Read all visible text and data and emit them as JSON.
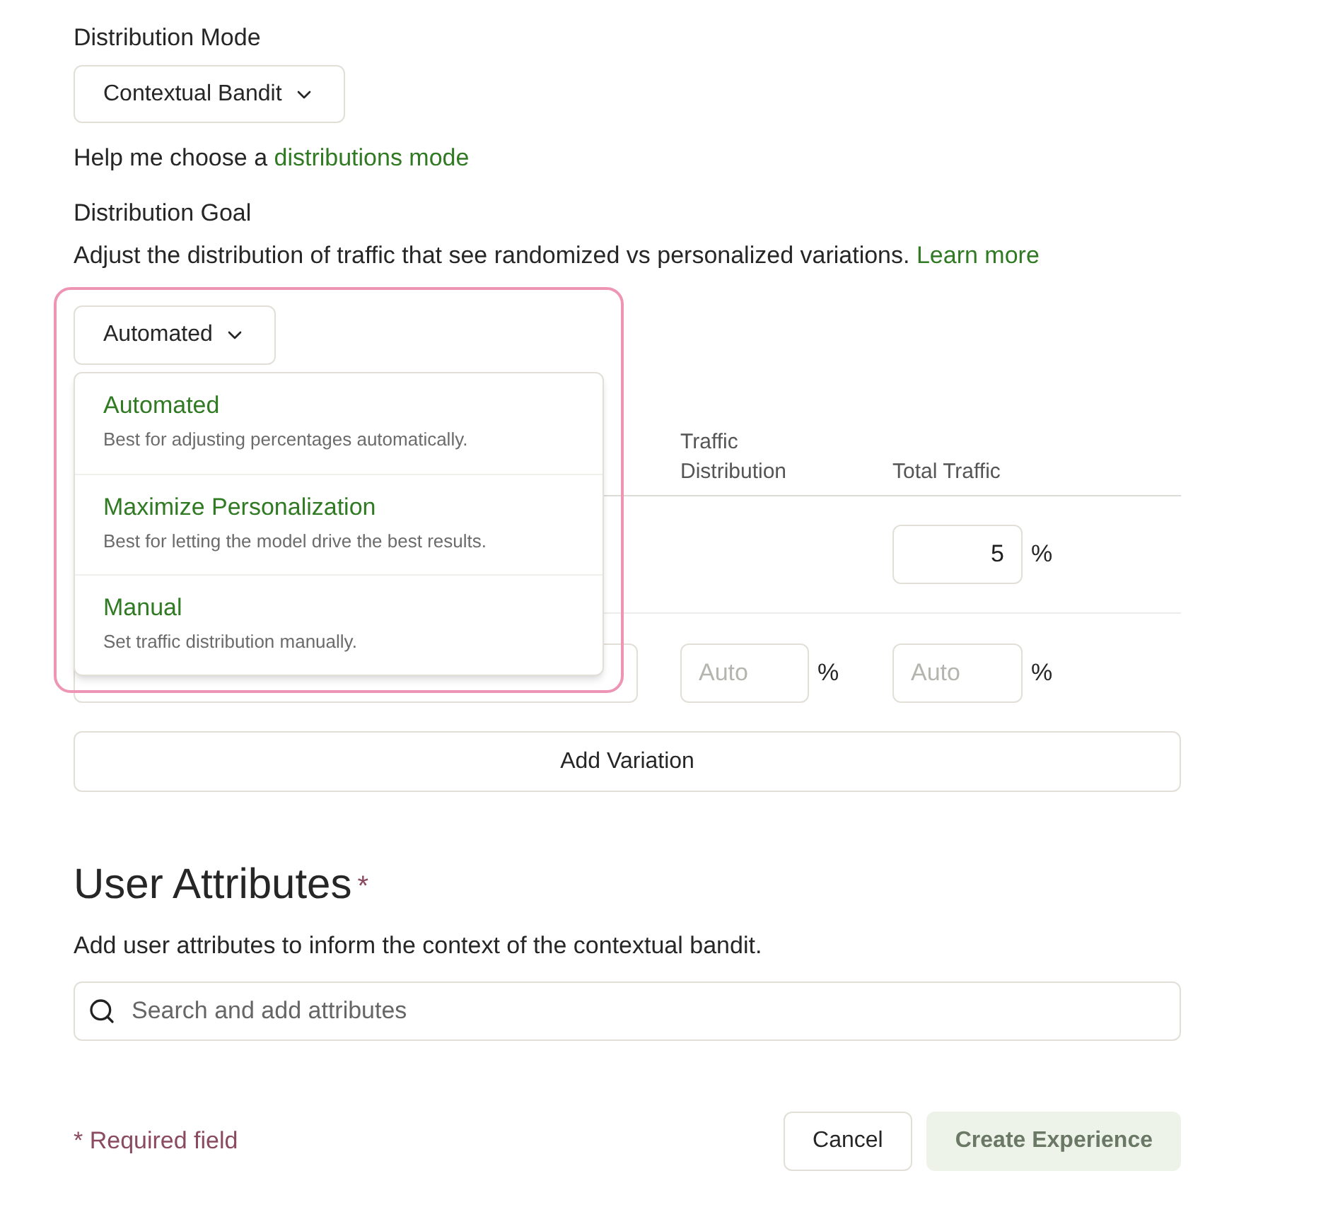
{
  "distribution_mode": {
    "label": "Distribution Mode",
    "value": "Contextual Bandit",
    "help_prefix": "Help me choose a ",
    "help_link": "distributions mode"
  },
  "distribution_goal": {
    "label": "Distribution Goal",
    "description": "Adjust the distribution of traffic that see randomized vs personalized variations.",
    "learn_more": "Learn more",
    "value": "Automated",
    "expanded": true,
    "options": [
      {
        "title": "Automated",
        "description": "Best for adjusting percentages automatically."
      },
      {
        "title": "Maximize Personalization",
        "description": "Best for letting the model drive the best results."
      },
      {
        "title": "Manual",
        "description": "Set traffic distribution manually."
      }
    ]
  },
  "table": {
    "columns": [
      "Traffic Distribution",
      "Total Traffic"
    ],
    "control_row": {
      "total_traffic": "5",
      "unit": "%"
    },
    "variation_row": {
      "traffic_distribution_placeholder": "Auto",
      "total_traffic_placeholder": "Auto",
      "unit": "%"
    }
  },
  "add_variation": "Add Variation",
  "user_attributes": {
    "title": "User Attributes",
    "required_mark": "*",
    "description": "Add user attributes to inform the context of the contextual bandit.",
    "search_placeholder": "Search and add attributes"
  },
  "footer": {
    "required_note": "* Required field",
    "cancel": "Cancel",
    "create": "Create Experience",
    "create_disabled": true
  }
}
